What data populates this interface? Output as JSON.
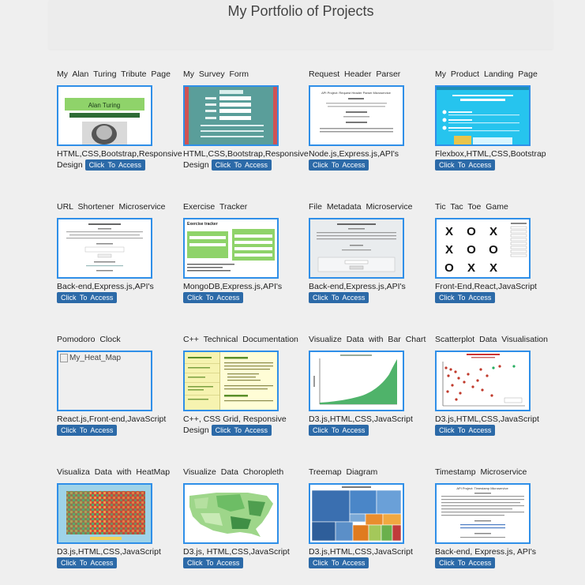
{
  "header": {
    "title": "My Portfolio of Projects"
  },
  "projects": [
    {
      "title": "My Alan Turing Tribute Page",
      "tags": "HTML,CSS,Bootstrap,Responsive Design",
      "button": "Click To Access",
      "thumb_text": "Alan Turing"
    },
    {
      "title": "My Survey Form",
      "tags": "HTML,CSS,Bootstrap,Responsive Design",
      "button": "Click To Access"
    },
    {
      "title": "Request Header Parser",
      "tags": "Node.js,Express.js,API's",
      "button": "Click To Access",
      "thumb_text": "API Project: Request Header Parser Microservice"
    },
    {
      "title": "My Product Landing Page",
      "tags": "Flexbox,HTML,CSS,Bootstrap",
      "button": "Click To Access"
    },
    {
      "title": "URL Shortener Microservice",
      "tags": "Back-end,Express.js,API's",
      "button": "Click To Access"
    },
    {
      "title": "Exercise Tracker",
      "tags": "MongoDB,Express.js,API's",
      "button": "Click To Access",
      "thumb_text": "Exercise tracker"
    },
    {
      "title": "File Metadata Microservice",
      "tags": "Back-end,Express.js,API's",
      "button": "Click To Access"
    },
    {
      "title": "Tic Tac Toe Game",
      "tags": "Front-End,React,JavaScript",
      "button": "Click To Access",
      "board": [
        "X",
        "O",
        "X",
        "X",
        "O",
        "O",
        "O",
        "X",
        "X"
      ]
    },
    {
      "title": "Pomodoro Clock",
      "tags": "React.js,Front-end,JavaScript",
      "button": "Click To Access",
      "alt": "My_Heat_Map"
    },
    {
      "title": "C++ Technical Documentation",
      "tags": "C++, CSS Grid, Responsive Design",
      "button": "Click To Access"
    },
    {
      "title": "Visualize Data with Bar Chart",
      "tags": "D3.js,HTML,CSS,JavaScript",
      "button": "Click To Access"
    },
    {
      "title": "Scatterplot Data Visualisation",
      "tags": "D3.js,HTML,CSS,JavaScript",
      "button": "Click To Access"
    },
    {
      "title": "Visualiza Data with HeatMap",
      "tags": "D3.js,HTML,CSS,JavaScript",
      "button": "Click To Access"
    },
    {
      "title": "Visualize Data Choropleth",
      "tags": "D3.js, HTML,CSS,JavaScript",
      "button": "Click To Access"
    },
    {
      "title": "Treemap Diagram",
      "tags": "D3.js,HTML,CSS,JavaScript",
      "button": "Click To Access"
    },
    {
      "title": "Timestamp Microservice",
      "tags": "Back-end, Express.js, API's",
      "button": "Click To Access",
      "thumb_text": "API Project: Timestamp Microservice"
    }
  ],
  "colors": {
    "accent": "#2f8fe8",
    "button": "#2c6aa8",
    "background": "#efefef"
  }
}
